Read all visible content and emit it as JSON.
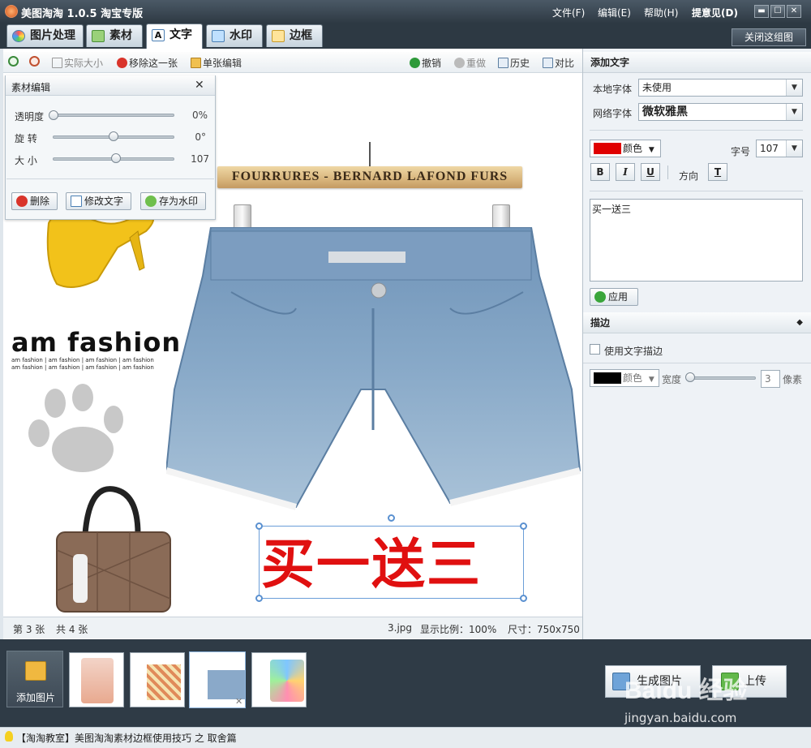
{
  "app": {
    "title": "美图淘淘 1.0.5 淘宝专版",
    "menu": [
      "文件(F)",
      "编辑(E)",
      "帮助(H)",
      "提意见(D)"
    ],
    "window_controls": [
      "▬",
      "☐",
      "✕"
    ]
  },
  "tabs": [
    {
      "label": "图片处理",
      "icon": "image-process-icon",
      "active": false
    },
    {
      "label": "素材",
      "icon": "material-icon",
      "active": false
    },
    {
      "label": "文字",
      "icon": "text-icon",
      "active": true
    },
    {
      "label": "水印",
      "icon": "watermark-icon",
      "active": false
    },
    {
      "label": "边框",
      "icon": "border-icon",
      "active": false
    }
  ],
  "close_group_label": "关闭这组图",
  "toolbar": {
    "actual_size": "实际大小",
    "remove_one": "移除这一张",
    "single_edit": "单张编辑",
    "undo": "撤销",
    "redo": "重做",
    "history": "历史",
    "compare": "对比"
  },
  "material_editor": {
    "title": "素材编辑",
    "close": "✕",
    "sliders": [
      {
        "label": "透明度",
        "value_text": "0%",
        "level": 0.0
      },
      {
        "label": "旋  转",
        "value_text": "0°",
        "level": 0.5
      },
      {
        "label": "大  小",
        "value_text": "107",
        "level": 0.52
      }
    ],
    "buttons": {
      "delete": "删除",
      "edit_text": "修改文字",
      "save_watermark": "存为水印"
    }
  },
  "canvas": {
    "hanger_label": "FOURRURES - BERNARD LAFOND FURS",
    "fashion_title": "am fashion",
    "fashion_small": "am fashion | am fashion | am fashion | am fashion",
    "overlay_text": "买一送三",
    "overlay_color": "#e01010"
  },
  "status": {
    "page": "第 3 张",
    "total": "共 4 张",
    "filename": "3.jpg",
    "scale": "显示比例：100%",
    "size": "尺寸：750x750"
  },
  "right": {
    "add_text_title": "添加文字",
    "local_font_label": "本地字体",
    "local_font_value": "未使用",
    "web_font_label": "网络字体",
    "web_font_value": "微软雅黑",
    "color_label": "颜色",
    "text_color": "#e00000",
    "font_size_label": "字号",
    "font_size_value": "107",
    "bold": "B",
    "italic": "I",
    "underline": "U",
    "direction_label": "方向",
    "direction_btn": "T",
    "text_content": "买一送三",
    "apply": "应用",
    "stroke_title": "描边",
    "use_stroke": "使用文字描边",
    "stroke_color_label": "颜色",
    "stroke_color": "#000000",
    "width_label": "宽度",
    "width_value": "3",
    "pixel_label": "像素"
  },
  "bottom": {
    "add_image": "添加图片",
    "generate": "生成图片",
    "upload": "上传"
  },
  "footer": "【淘淘教室】美图淘淘素材边框使用技巧 之 取舍篇",
  "watermark": {
    "brand": "Baidu 经验",
    "url": "jingyan.baidu.com"
  }
}
